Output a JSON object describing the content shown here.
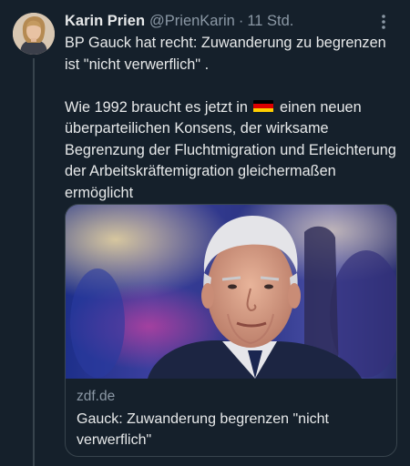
{
  "tweet": {
    "author_name": "Karin Prien",
    "handle": "@PrienKarin",
    "separator": "·",
    "time": "11 Std.",
    "paragraph1": "BP Gauck hat recht: Zuwanderung zu begrenzen ist \"nicht verwerflich\" .",
    "paragraph2_before_flag": "Wie 1992 braucht es jetzt in",
    "flag_icon": "germany-flag-icon",
    "paragraph2_after_flag": "einen neuen überparteilichen Konsens, der wirksame Begrenzung der Fluchtmigration und Erleichterung der Arbeitskräftemigration gleichermaßen ermöglicht"
  },
  "link_card": {
    "domain": "zdf.de",
    "title": "Gauck: Zuwanderung begrenzen \"nicht verwerflich\""
  },
  "colors": {
    "background": "#15202b",
    "text": "#e7e9ea",
    "secondary_text": "#8b98a5",
    "border": "#38444d"
  }
}
